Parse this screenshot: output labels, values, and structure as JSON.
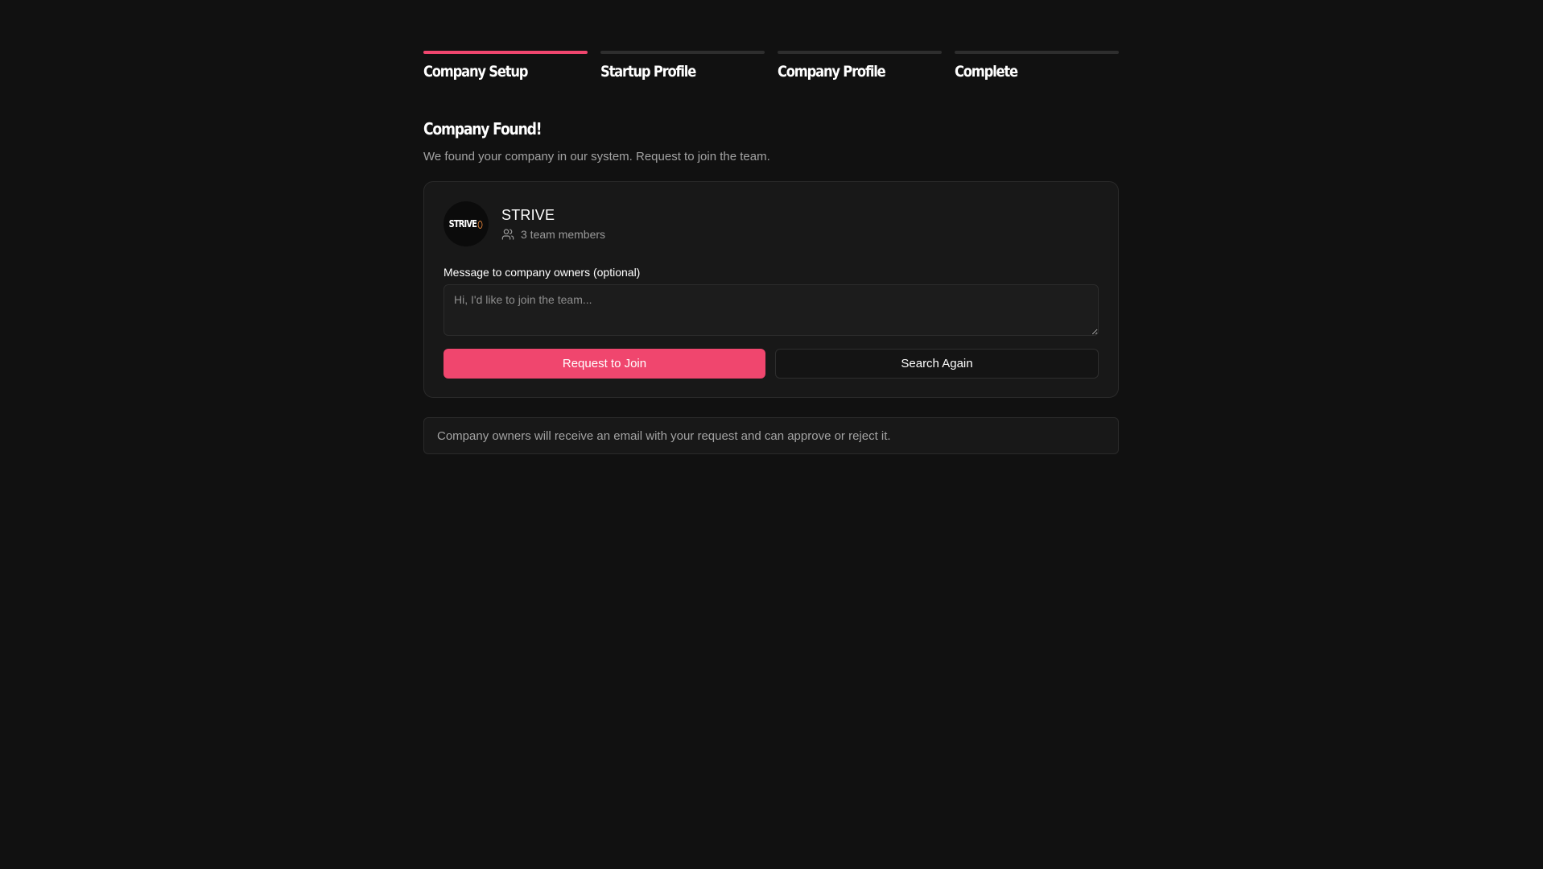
{
  "stepper": {
    "steps": [
      {
        "label": "Company Setup",
        "active": true
      },
      {
        "label": "Startup Profile",
        "active": false
      },
      {
        "label": "Company Profile",
        "active": false
      },
      {
        "label": "Complete",
        "active": false
      }
    ]
  },
  "main": {
    "heading": "Company Found!",
    "subtitle": "We found your company in our system. Request to join the team."
  },
  "company": {
    "logo_text": "STRIVE",
    "name": "STRIVE",
    "members": "3 team members",
    "members_icon": "users-icon"
  },
  "message": {
    "label": "Message to company owners (optional)",
    "placeholder": "Hi, I'd like to join the team...",
    "value": ""
  },
  "actions": {
    "request_label": "Request to Join",
    "search_label": "Search Again"
  },
  "note": {
    "text": "Company owners will receive an email with your request and can approve or reject it."
  },
  "colors": {
    "accent": "#f0466e",
    "background": "#111111",
    "card": "#181818",
    "logo_accent": "#f08a3c"
  }
}
